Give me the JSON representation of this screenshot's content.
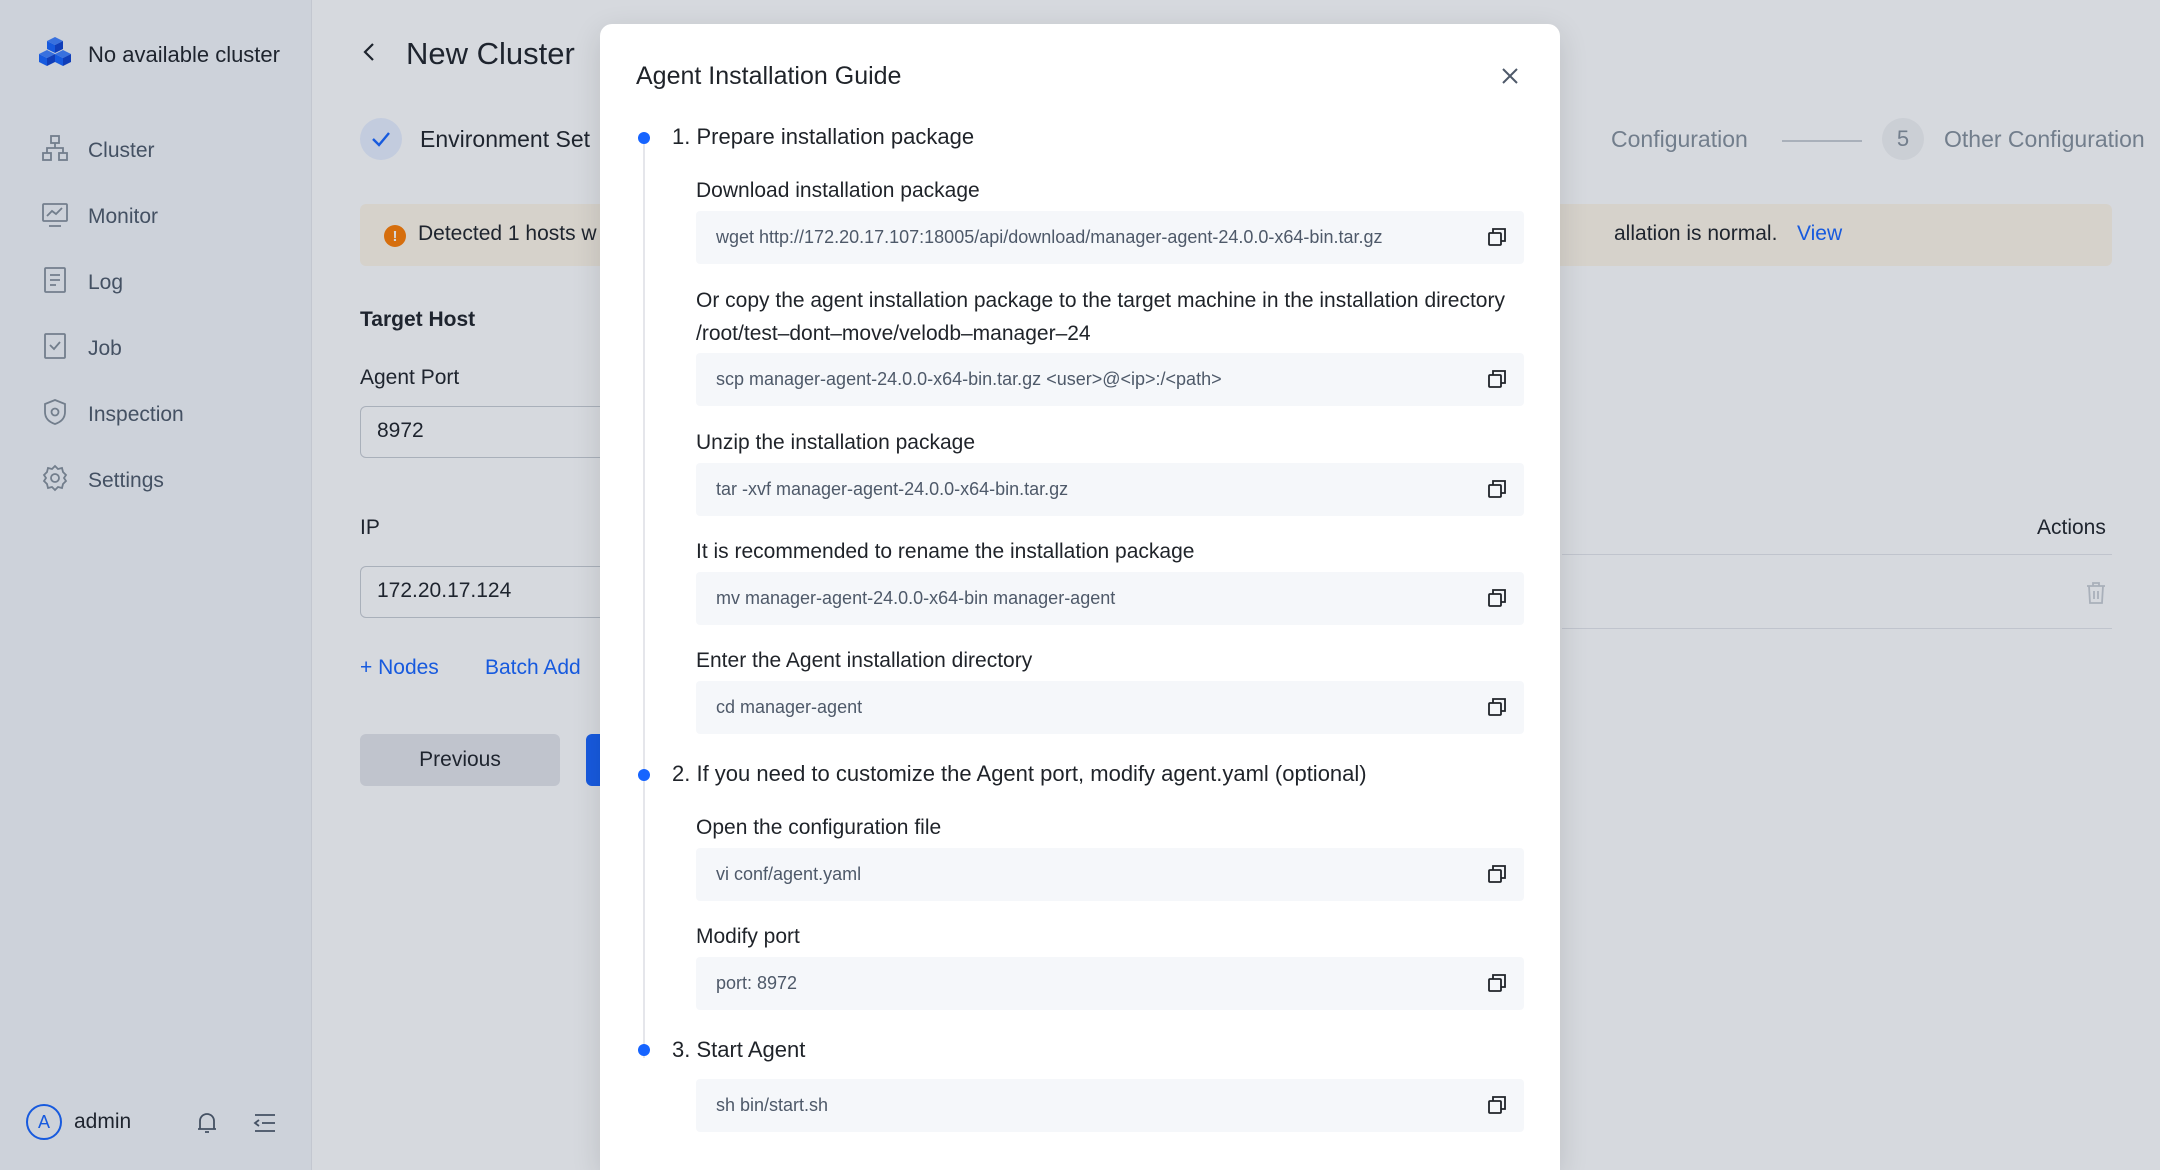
{
  "sidebar": {
    "brand": {
      "title": "No available cluster",
      "icon": "cubes-logo-icon"
    },
    "items": [
      {
        "label": "Cluster",
        "icon": "cluster-icon"
      },
      {
        "label": "Monitor",
        "icon": "monitor-icon"
      },
      {
        "label": "Log",
        "icon": "log-icon"
      },
      {
        "label": "Job",
        "icon": "job-icon"
      },
      {
        "label": "Inspection",
        "icon": "shield-icon"
      },
      {
        "label": "Settings",
        "icon": "gear-icon"
      }
    ],
    "user": {
      "avatar": "A",
      "name": "admin"
    }
  },
  "page": {
    "title": "New Cluster",
    "steps": {
      "step1": "Environment Set",
      "step4": "Configuration",
      "step5_number": "5",
      "step5": "Other Configuration"
    },
    "alert": {
      "text_left": "Detected 1 hosts w",
      "text_right": "allation is normal.",
      "link": "View"
    },
    "target_host_label": "Target Host",
    "agent_port_label": "Agent Port",
    "agent_port_value": "8972",
    "ip_label": "IP",
    "ip_value": "172.20.17.124",
    "actions_label": "Actions",
    "add_nodes": "+ Nodes",
    "batch_add": "Batch Add",
    "previous": "Previous"
  },
  "modal": {
    "title": "Agent Installation Guide",
    "sections": [
      {
        "title": "1. Prepare installation package"
      },
      {
        "title": "2. If you need to customize the Agent port, modify agent.yaml (optional)"
      },
      {
        "title": "3. Start Agent"
      }
    ],
    "steps": [
      {
        "label": "Download installation package",
        "code": "wget http://172.20.17.107:18005/api/download/manager-agent-24.0.0-x64-bin.tar.gz"
      },
      {
        "label": "Or copy the agent installation package to the target machine in the installation directory /root/test–dont–move/velodb–manager–24",
        "code": "scp manager-agent-24.0.0-x64-bin.tar.gz <user>@<ip>:/<path>"
      },
      {
        "label": "Unzip the installation package",
        "code": "tar -xvf manager-agent-24.0.0-x64-bin.tar.gz"
      },
      {
        "label": "It is recommended to rename the installation package",
        "code": "mv manager-agent-24.0.0-x64-bin manager-agent"
      },
      {
        "label": "Enter the Agent installation directory",
        "code": "cd manager-agent"
      },
      {
        "label": "Open the configuration file",
        "code": "vi conf/agent.yaml"
      },
      {
        "label": "Modify port",
        "code": "port: 8972"
      },
      {
        "label": "",
        "code": "sh bin/start.sh"
      }
    ]
  }
}
